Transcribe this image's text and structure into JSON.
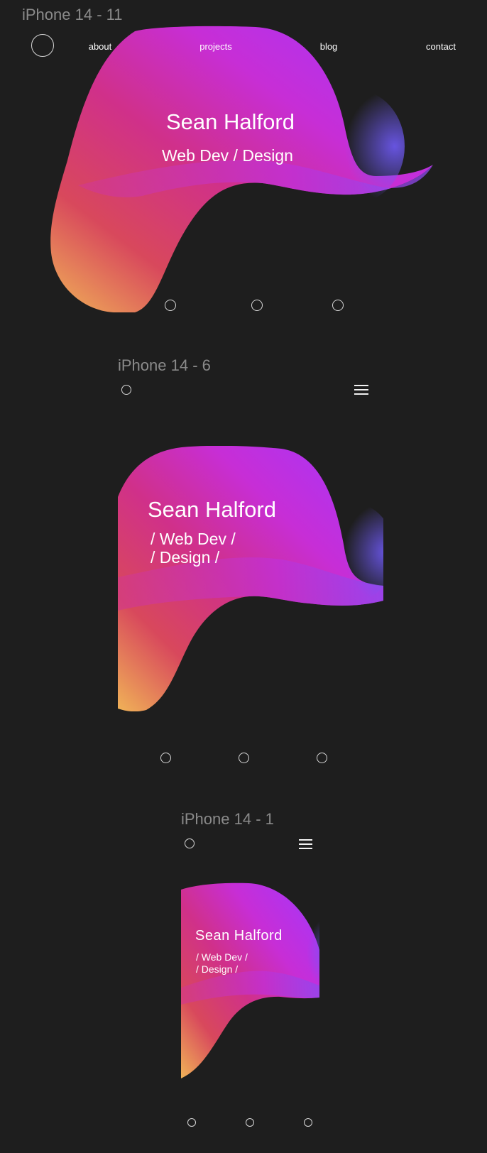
{
  "frames": {
    "desktop": {
      "title": "iPhone 14 - 11",
      "nav": {
        "about": "about",
        "projects": "projects",
        "blog": "blog",
        "contact": "contact"
      },
      "hero_name": "Sean Halford",
      "hero_sub": "Web Dev / Design"
    },
    "tablet": {
      "title": "iPhone 14 - 6",
      "hero_name": "Sean Halford",
      "hero_sub_line1": "/ Web Dev /",
      "hero_sub_line2": "/ Design /"
    },
    "mobile": {
      "title": "iPhone 14 - 1",
      "hero_name": "Sean Halford",
      "hero_sub_line1": "/ Web Dev /",
      "hero_sub_line2": "/ Design /"
    }
  },
  "colors": {
    "background": "#1e1e1e",
    "gradient_magenta": "#c52de0",
    "gradient_pink": "#d4327a",
    "gradient_orange": "#e8a25a",
    "gradient_violet": "#7a55f0",
    "title_gray": "#8a8a8a"
  },
  "icons": {
    "logo": "circle-outline-icon",
    "menu": "hamburger-menu-icon",
    "pagination": "circle-outline-icon"
  }
}
